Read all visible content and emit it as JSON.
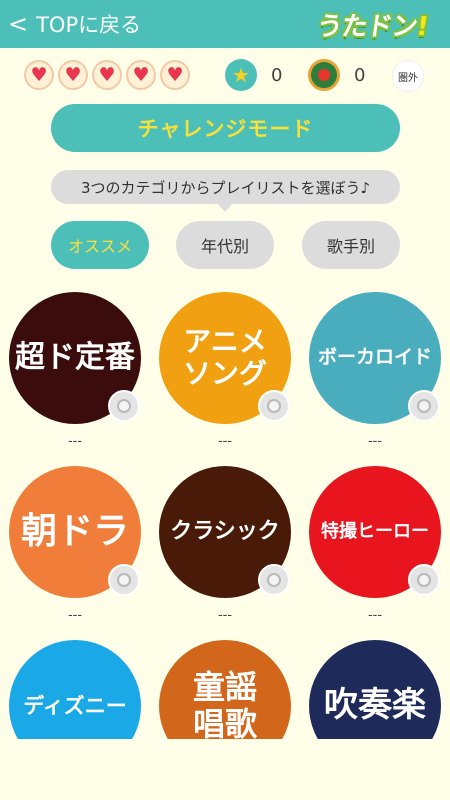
{
  "header": {
    "back_chevron": "<",
    "back_label": "TOPに戻る",
    "logo_main": "うたドン",
    "logo_bang": "!"
  },
  "status": {
    "hearts": [
      "♥",
      "♥",
      "♥",
      "♥",
      "♥"
    ],
    "star_icon": "★",
    "star_count": "0",
    "medal_count": "0",
    "rank_label": "圏外"
  },
  "challenge_label": "チャレンジモード",
  "hint": "3つのカテゴリからプレイリストを選ぼう♪",
  "tabs": [
    "オススメ",
    "年代別",
    "歌手別"
  ],
  "categories": [
    {
      "name": "超ド定番",
      "score": "---",
      "color": "#3a0c0c"
    },
    {
      "name": "アニメソング",
      "score": "---",
      "color": "#f0a010"
    },
    {
      "name": "ボーカロイド",
      "score": "---",
      "color": "#4aadbe"
    },
    {
      "name": "朝ドラ",
      "score": "---",
      "color": "#f07e3a"
    },
    {
      "name": "クラシック",
      "score": "---",
      "color": "#4a1a08"
    },
    {
      "name": "特撮ヒーロー",
      "score": "---",
      "color": "#e8141e"
    },
    {
      "name": "ディズニー",
      "score": "",
      "color": "#1aa8e6"
    },
    {
      "name": "童謡唱歌",
      "score": "",
      "color": "#d2661a"
    },
    {
      "name": "吹奏楽",
      "score": "",
      "color": "#1e2a5a"
    }
  ],
  "colors": {
    "accent": "#4cc0b8",
    "highlight": "#f8e03a",
    "background": "#fefee9"
  }
}
